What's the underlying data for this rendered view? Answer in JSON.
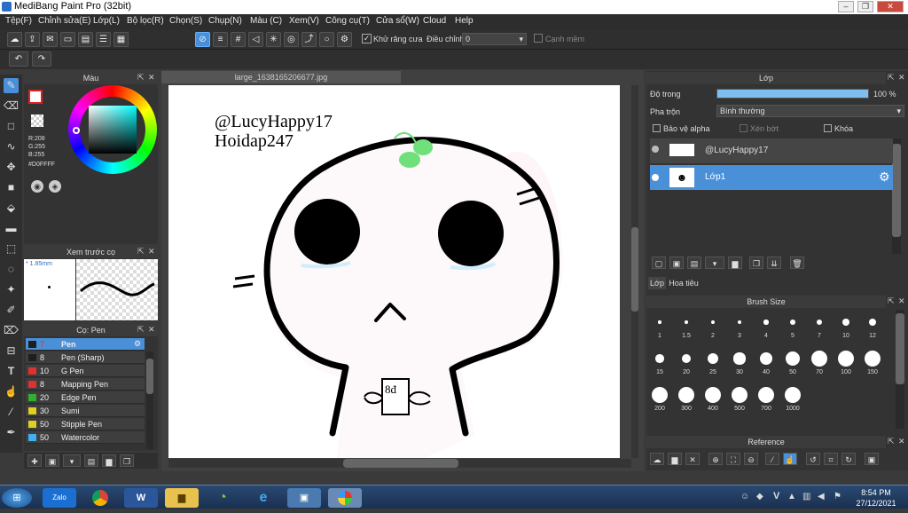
{
  "window": {
    "title": "MediBang Paint Pro (32bit)"
  },
  "menu": [
    "Tệp(F)",
    "Chỉnh sửa(E)",
    "Lớp(L)",
    "Bộ lọc(R)",
    "Chọn(S)",
    "Chụp(N)",
    "Màu (C)",
    "Xem(V)",
    "Công cụ(T)",
    "Cửa sổ(W)",
    "Cloud",
    "Help"
  ],
  "toolbar": {
    "antialias_label": "Khử răng cưa",
    "adjust_label": "Điều chỉnh",
    "adjust_value": "0",
    "edge_label": "Cạnh mềm"
  },
  "color_panel": {
    "title": "Màu",
    "r": "R:208",
    "g": "G:255",
    "b": "B:255",
    "hex": "#D0FFFF"
  },
  "preview_panel": {
    "title": "Xem trước cọ",
    "size": "* 1.85mm"
  },
  "brush_panel": {
    "title": "Cọ: Pen",
    "items": [
      {
        "num": "7",
        "name": "Pen",
        "color": "#1e1e1e"
      },
      {
        "num": "8",
        "name": "Pen (Sharp)",
        "color": "#1e1e1e"
      },
      {
        "num": "10",
        "name": "G Pen",
        "color": "#e03030"
      },
      {
        "num": "8",
        "name": "Mapping Pen",
        "color": "#e03030"
      },
      {
        "num": "20",
        "name": "Edge Pen",
        "color": "#30b030"
      },
      {
        "num": "30",
        "name": "Sumi",
        "color": "#e0d020"
      },
      {
        "num": "50",
        "name": "Stipple Pen",
        "color": "#e0d020"
      },
      {
        "num": "50",
        "name": "Watercolor",
        "color": "#40b0f0"
      }
    ]
  },
  "document": {
    "tab": "large_1638165206677.jpg",
    "text1": "@LucyHappy17",
    "text2": "Hoidap247",
    "badge": "8đ"
  },
  "layer_panel": {
    "title": "Lớp",
    "opacity_label": "Độ trong",
    "opacity_value": "100 %",
    "opacity_fraction": 1.0,
    "blend_label": "Pha trộn",
    "blend_value": "Bình thường",
    "protect_alpha": "Bảo vệ alpha",
    "clip": "Xén bớt",
    "lock": "Khóa",
    "layers": [
      {
        "name": "@LucyHappy17"
      },
      {
        "name": "Lớp1"
      }
    ],
    "tabs": [
      "Lớp",
      "Hoa tiêu"
    ]
  },
  "brush_size_panel": {
    "title": "Brush Size",
    "sizes": [
      "1",
      "1.5",
      "2",
      "3",
      "4",
      "5",
      "7",
      "10",
      "12",
      "15",
      "20",
      "25",
      "30",
      "40",
      "50",
      "70",
      "100",
      "150",
      "200",
      "300",
      "400",
      "500",
      "700",
      "1000"
    ]
  },
  "reference_panel": {
    "title": "Reference"
  },
  "taskbar": {
    "time": "8:54 PM",
    "date": "27/12/2021"
  }
}
